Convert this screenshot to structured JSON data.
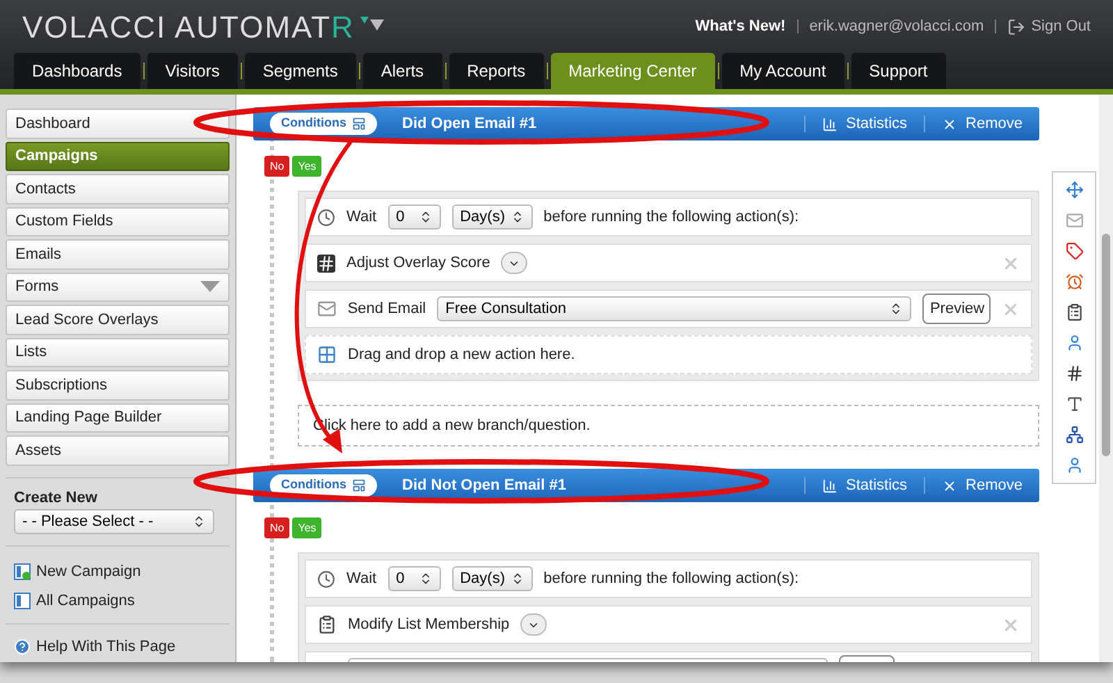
{
  "logo": {
    "main": "VOLACCI AUTOMAT",
    "accent": "R"
  },
  "header_links": {
    "whats_new": "What's New!",
    "email": "erik.wagner@volacci.com",
    "sign_out": "Sign Out"
  },
  "nav_tabs": [
    {
      "label": "Dashboards",
      "selected": false
    },
    {
      "label": "Visitors",
      "selected": false
    },
    {
      "label": "Segments",
      "selected": false
    },
    {
      "label": "Alerts",
      "selected": false
    },
    {
      "label": "Reports",
      "selected": false
    },
    {
      "label": "Marketing Center",
      "selected": true
    },
    {
      "label": "My Account",
      "selected": false
    },
    {
      "label": "Support",
      "selected": false
    }
  ],
  "sidebar": {
    "items": [
      {
        "label": "Dashboard",
        "selected": false,
        "has_menu": false
      },
      {
        "label": "Campaigns",
        "selected": true,
        "has_menu": false
      },
      {
        "label": "Contacts",
        "selected": false,
        "has_menu": false
      },
      {
        "label": "Custom Fields",
        "selected": false,
        "has_menu": false
      },
      {
        "label": "Emails",
        "selected": false,
        "has_menu": false
      },
      {
        "label": "Forms",
        "selected": false,
        "has_menu": true
      },
      {
        "label": "Lead Score Overlays",
        "selected": false,
        "has_menu": false
      },
      {
        "label": "Lists",
        "selected": false,
        "has_menu": false
      },
      {
        "label": "Subscriptions",
        "selected": false,
        "has_menu": false
      },
      {
        "label": "Landing Page Builder",
        "selected": false,
        "has_menu": false
      },
      {
        "label": "Assets",
        "selected": false,
        "has_menu": false
      }
    ],
    "create_new": {
      "label": "Create New",
      "value": "- - Please Select - -"
    },
    "links": [
      {
        "kind": "new",
        "label": "New Campaign"
      },
      {
        "kind": "all",
        "label": "All Campaigns"
      }
    ],
    "help": "Help With This Page"
  },
  "branches": [
    {
      "conditions": "Conditions",
      "title": "Did Open Email #1",
      "statistics": "Statistics",
      "remove": "Remove",
      "no": "No",
      "yes": "Yes",
      "actions": [
        {
          "kind": "wait",
          "label": "Wait",
          "number": "0",
          "unit": "Day(s)",
          "suffix": "before running the following action(s):"
        },
        {
          "kind": "score",
          "label": "Adjust Overlay Score"
        },
        {
          "kind": "email",
          "label": "Send Email",
          "value": "Free Consultation",
          "button": "Preview"
        },
        {
          "kind": "drop",
          "label": "Drag and drop a new action here."
        }
      ],
      "add_branch": "Click here to add a new branch/question."
    },
    {
      "conditions": "Conditions",
      "title": "Did Not Open Email #1",
      "statistics": "Statistics",
      "remove": "Remove",
      "no": "No",
      "yes": "Yes",
      "actions": [
        {
          "kind": "wait",
          "label": "Wait",
          "number": "0",
          "unit": "Day(s)",
          "suffix": "before running the following action(s):"
        },
        {
          "kind": "list",
          "label": "Modify List Membership"
        },
        {
          "kind": "email"
        }
      ]
    }
  ]
}
